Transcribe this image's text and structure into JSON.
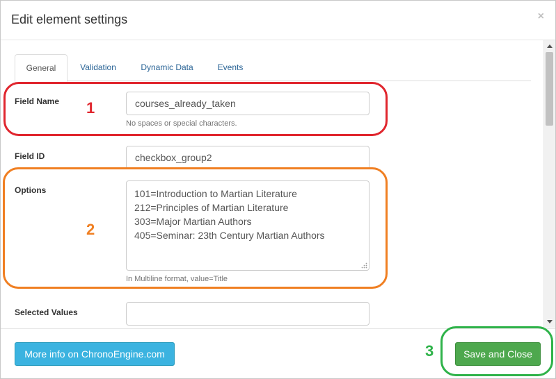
{
  "dialog": {
    "title": "Edit element settings",
    "close_label": "×"
  },
  "tabs": [
    {
      "label": "General",
      "active": true
    },
    {
      "label": "Validation",
      "active": false
    },
    {
      "label": "Dynamic Data",
      "active": false
    },
    {
      "label": "Events",
      "active": false
    }
  ],
  "form": {
    "field_name": {
      "label": "Field Name",
      "value": "courses_already_taken",
      "help": "No spaces or special characters."
    },
    "field_id": {
      "label": "Field ID",
      "value": "checkbox_group2"
    },
    "options": {
      "label": "Options",
      "lines": [
        "101=Introduction to Martian Literature",
        "212=Principles of Martian Literature",
        "303=Major Martian Authors",
        "405=Seminar: 23th Century Martian Authors"
      ],
      "help": "In Multiline format, value=Title"
    },
    "selected_values": {
      "label": "Selected Values",
      "value": ""
    }
  },
  "annotations": [
    {
      "number": "1",
      "color": "#e0262e"
    },
    {
      "number": "2",
      "color": "#f07f22"
    },
    {
      "number": "3",
      "color": "#2fb34a"
    }
  ],
  "footer": {
    "more_info_label": "More info on ChronoEngine.com",
    "save_close_label": "Save and Close"
  }
}
